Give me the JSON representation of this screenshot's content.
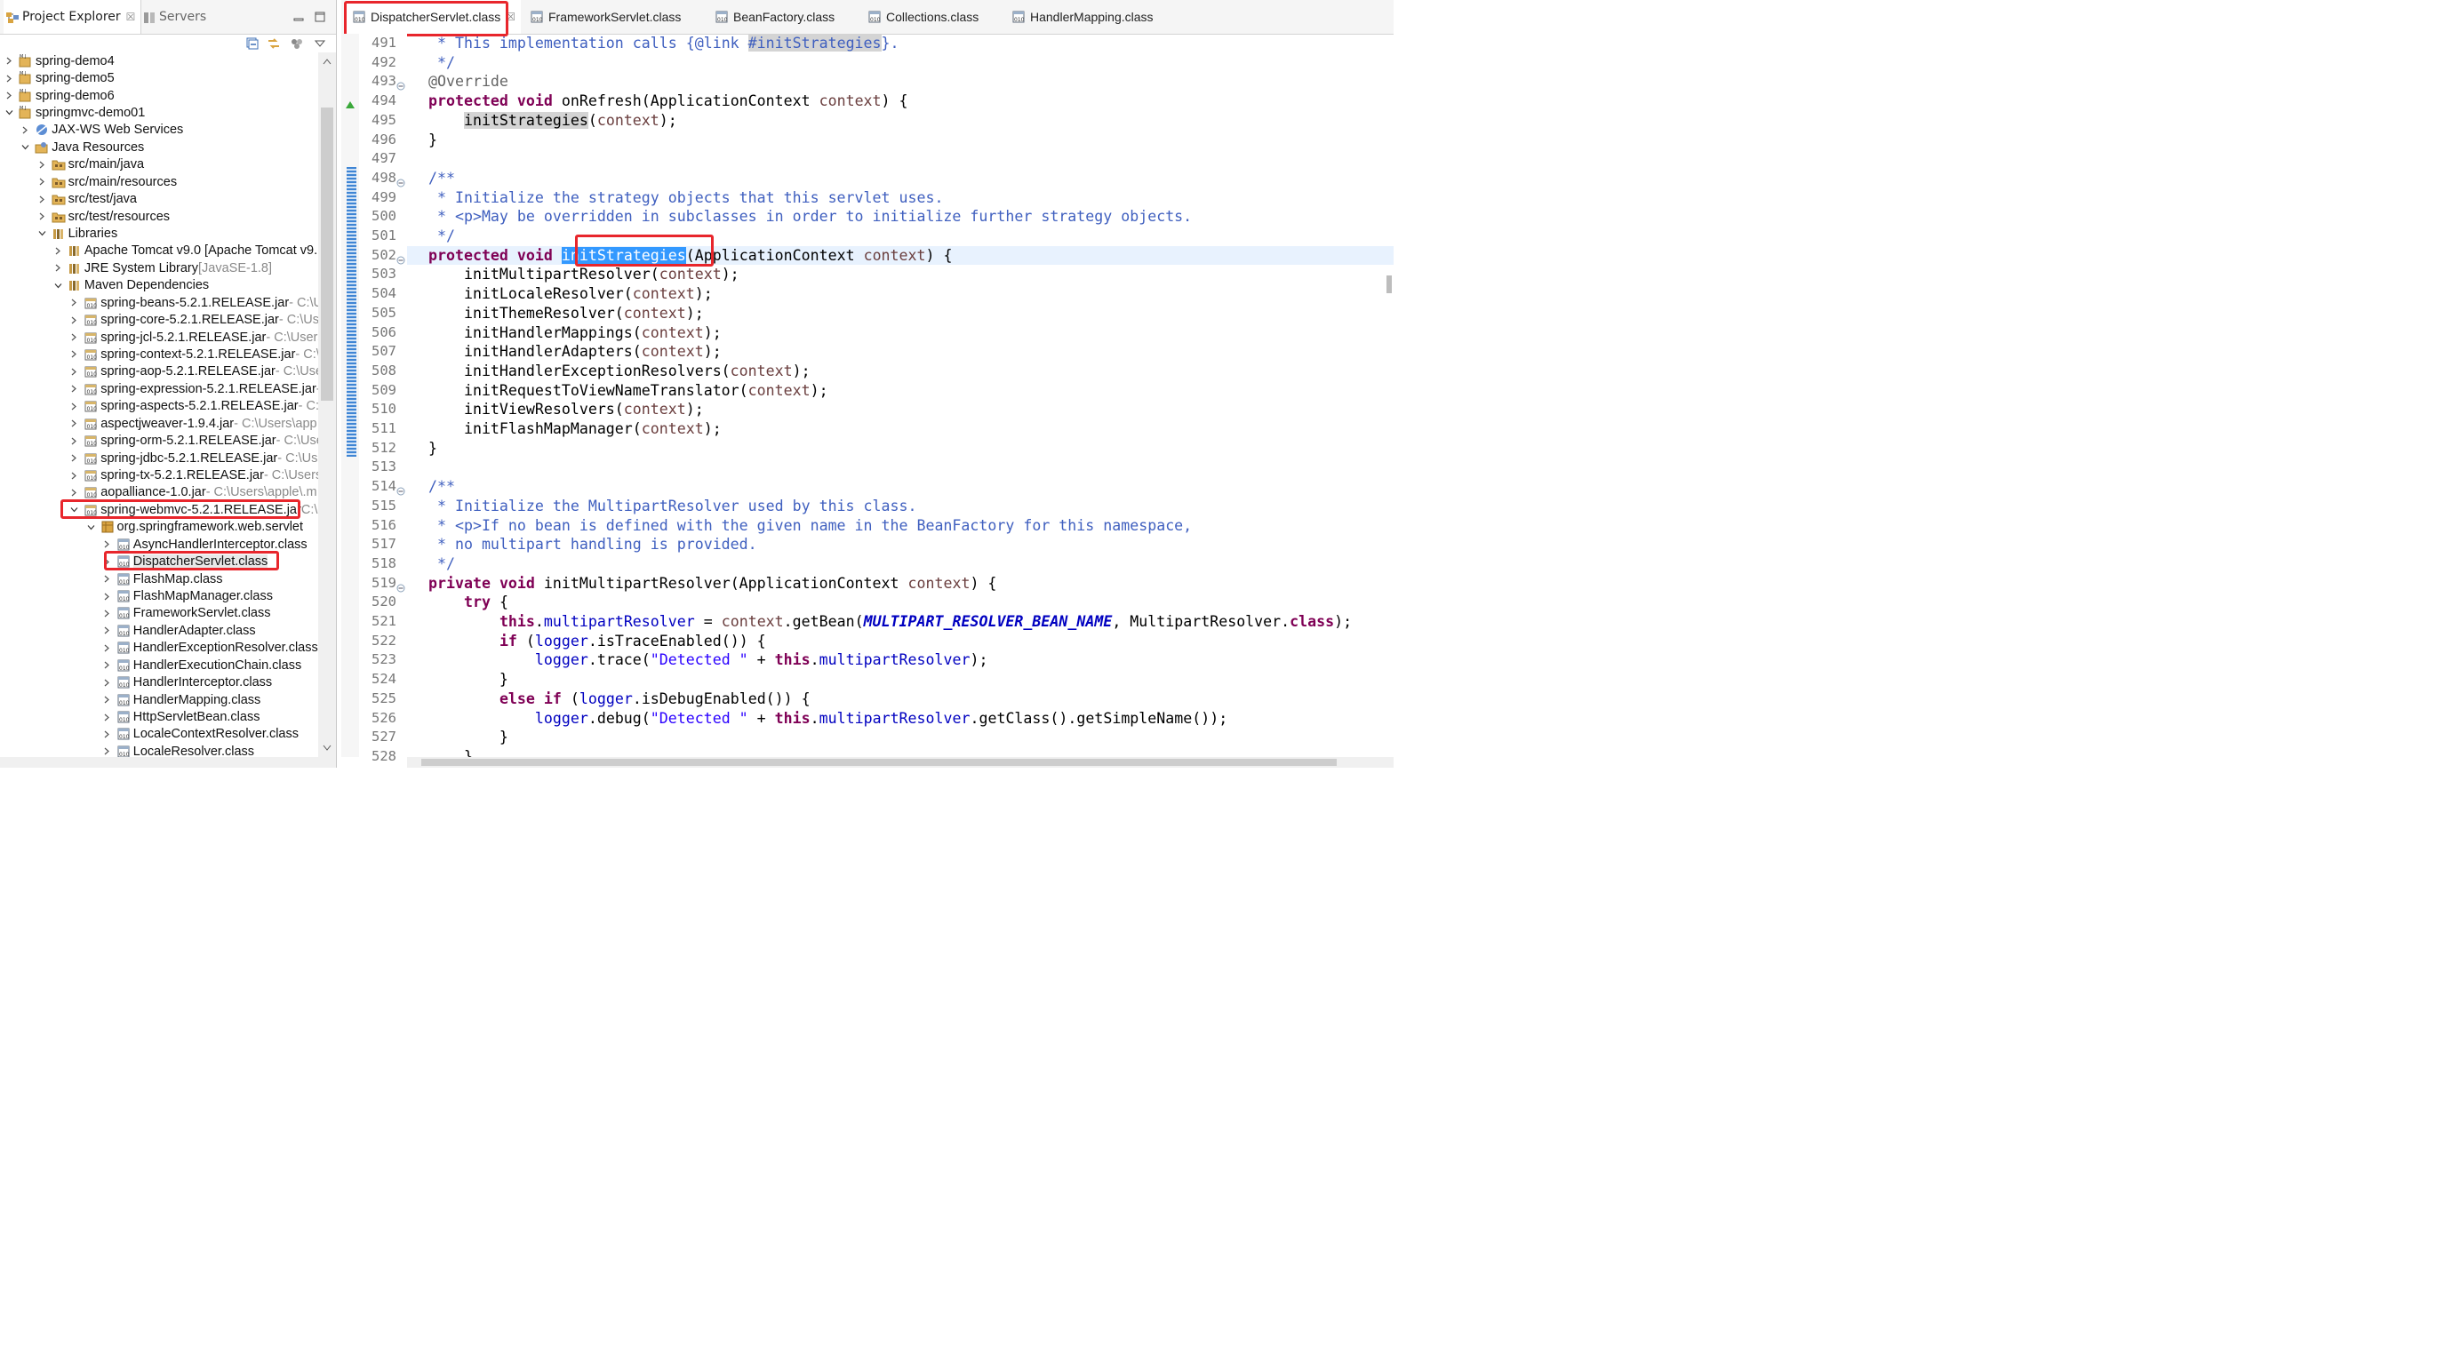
{
  "left_panel": {
    "tabs": [
      {
        "label": "Project Explorer",
        "close": "☒"
      },
      {
        "label": "Servers"
      }
    ],
    "tree": [
      {
        "indent": 0,
        "exp": "closed",
        "icon": "project",
        "label": "spring-demo4",
        "suffix": ""
      },
      {
        "indent": 0,
        "exp": "closed",
        "icon": "project",
        "label": "spring-demo5",
        "suffix": ""
      },
      {
        "indent": 0,
        "exp": "closed",
        "icon": "project",
        "label": "spring-demo6",
        "suffix": ""
      },
      {
        "indent": 0,
        "exp": "open",
        "icon": "project",
        "label": "springmvc-demo01",
        "suffix": ""
      },
      {
        "indent": 1,
        "exp": "closed",
        "icon": "webservice",
        "label": "JAX-WS Web Services",
        "suffix": ""
      },
      {
        "indent": 1,
        "exp": "open",
        "icon": "java-resources",
        "label": "Java Resources",
        "suffix": ""
      },
      {
        "indent": 2,
        "exp": "closed",
        "icon": "source-folder",
        "label": "src/main/java",
        "suffix": ""
      },
      {
        "indent": 2,
        "exp": "closed",
        "icon": "source-folder",
        "label": "src/main/resources",
        "suffix": ""
      },
      {
        "indent": 2,
        "exp": "closed",
        "icon": "source-folder",
        "label": "src/test/java",
        "suffix": ""
      },
      {
        "indent": 2,
        "exp": "closed",
        "icon": "source-folder",
        "label": "src/test/resources",
        "suffix": ""
      },
      {
        "indent": 2,
        "exp": "open",
        "icon": "library",
        "label": "Libraries",
        "suffix": ""
      },
      {
        "indent": 3,
        "exp": "closed",
        "icon": "library",
        "label": "Apache Tomcat v9.0 [Apache Tomcat v9.",
        "suffix": ""
      },
      {
        "indent": 3,
        "exp": "closed",
        "icon": "library",
        "label": "JRE System Library ",
        "suffix": "[JavaSE-1.8]"
      },
      {
        "indent": 3,
        "exp": "open",
        "icon": "library",
        "label": "Maven Dependencies",
        "suffix": ""
      },
      {
        "indent": 4,
        "exp": "closed",
        "icon": "jar",
        "label": "spring-beans-5.2.1.RELEASE.jar",
        "suffix": " - C:\\Us"
      },
      {
        "indent": 4,
        "exp": "closed",
        "icon": "jar",
        "label": "spring-core-5.2.1.RELEASE.jar",
        "suffix": " - C:\\Use"
      },
      {
        "indent": 4,
        "exp": "closed",
        "icon": "jar",
        "label": "spring-jcl-5.2.1.RELEASE.jar",
        "suffix": " - C:\\Users\\"
      },
      {
        "indent": 4,
        "exp": "closed",
        "icon": "jar",
        "label": "spring-context-5.2.1.RELEASE.jar",
        "suffix": " - C:\\U"
      },
      {
        "indent": 4,
        "exp": "closed",
        "icon": "jar",
        "label": "spring-aop-5.2.1.RELEASE.jar",
        "suffix": " - C:\\User"
      },
      {
        "indent": 4,
        "exp": "closed",
        "icon": "jar",
        "label": "spring-expression-5.2.1.RELEASE.jar",
        "suffix": " -"
      },
      {
        "indent": 4,
        "exp": "closed",
        "icon": "jar",
        "label": "spring-aspects-5.2.1.RELEASE.jar",
        "suffix": " - C:\\"
      },
      {
        "indent": 4,
        "exp": "closed",
        "icon": "jar",
        "label": "aspectjweaver-1.9.4.jar",
        "suffix": " - C:\\Users\\app"
      },
      {
        "indent": 4,
        "exp": "closed",
        "icon": "jar",
        "label": "spring-orm-5.2.1.RELEASE.jar",
        "suffix": " - C:\\Use"
      },
      {
        "indent": 4,
        "exp": "closed",
        "icon": "jar",
        "label": "spring-jdbc-5.2.1.RELEASE.jar",
        "suffix": " - C:\\Use"
      },
      {
        "indent": 4,
        "exp": "closed",
        "icon": "jar",
        "label": "spring-tx-5.2.1.RELEASE.jar",
        "suffix": " - C:\\Users\\"
      },
      {
        "indent": 4,
        "exp": "closed",
        "icon": "jar",
        "label": "aopalliance-1.0.jar",
        "suffix": " - C:\\Users\\apple\\.m"
      },
      {
        "indent": 4,
        "exp": "open",
        "icon": "jar",
        "label": "spring-webmvc-5.2.1.RELEASE.jar",
        "suffix": " C:\\"
      },
      {
        "indent": 5,
        "exp": "open",
        "icon": "package",
        "label": "org.springframework.web.servlet",
        "suffix": ""
      },
      {
        "indent": 6,
        "exp": "closed",
        "icon": "class-file",
        "label": "AsyncHandlerInterceptor.class",
        "suffix": ""
      },
      {
        "indent": 6,
        "exp": "closed",
        "icon": "class-file",
        "label": "DispatcherServlet.class",
        "suffix": "",
        "selected": true
      },
      {
        "indent": 6,
        "exp": "closed",
        "icon": "class-file",
        "label": "FlashMap.class",
        "suffix": ""
      },
      {
        "indent": 6,
        "exp": "closed",
        "icon": "class-file",
        "label": "FlashMapManager.class",
        "suffix": ""
      },
      {
        "indent": 6,
        "exp": "closed",
        "icon": "class-file",
        "label": "FrameworkServlet.class",
        "suffix": ""
      },
      {
        "indent": 6,
        "exp": "closed",
        "icon": "class-file",
        "label": "HandlerAdapter.class",
        "suffix": ""
      },
      {
        "indent": 6,
        "exp": "closed",
        "icon": "class-file",
        "label": "HandlerExceptionResolver.class",
        "suffix": ""
      },
      {
        "indent": 6,
        "exp": "closed",
        "icon": "class-file",
        "label": "HandlerExecutionChain.class",
        "suffix": ""
      },
      {
        "indent": 6,
        "exp": "closed",
        "icon": "class-file",
        "label": "HandlerInterceptor.class",
        "suffix": ""
      },
      {
        "indent": 6,
        "exp": "closed",
        "icon": "class-file",
        "label": "HandlerMapping.class",
        "suffix": ""
      },
      {
        "indent": 6,
        "exp": "closed",
        "icon": "class-file",
        "label": "HttpServletBean.class",
        "suffix": ""
      },
      {
        "indent": 6,
        "exp": "closed",
        "icon": "class-file",
        "label": "LocaleContextResolver.class",
        "suffix": ""
      },
      {
        "indent": 6,
        "exp": "closed",
        "icon": "class-file",
        "label": "LocaleResolver.class",
        "suffix": ""
      }
    ]
  },
  "editor": {
    "tabs": [
      {
        "label": "DispatcherServlet.class",
        "close": "☒"
      },
      {
        "label": "FrameworkServlet.class"
      },
      {
        "label": "BeanFactory.class"
      },
      {
        "label": "Collections.class"
      },
      {
        "label": "HandlerMapping.class"
      }
    ],
    "lines": [
      {
        "n": "491",
        "fold": "",
        "tokens": [
          [
            "cm",
            " * This implementation calls {"
          ],
          [
            "cm",
            "@link"
          ],
          [
            "cm",
            " "
          ],
          [
            "cm-occ",
            "#initStrategies"
          ],
          [
            "cm",
            "}."
          ]
        ]
      },
      {
        "n": "492",
        "fold": "",
        "tokens": [
          [
            "cm",
            " */"
          ]
        ]
      },
      {
        "n": "493",
        "fold": "⊖",
        "tokens": [
          [
            "ann",
            "@Override"
          ]
        ]
      },
      {
        "n": "494",
        "fold": "",
        "tokens": [
          [
            "kw",
            "protected"
          ],
          [
            "",
            " "
          ],
          [
            "kw",
            "void"
          ],
          [
            "",
            " onRefresh(ApplicationContext "
          ],
          [
            "par",
            "context"
          ],
          [
            "",
            ") {"
          ]
        ]
      },
      {
        "n": "495",
        "fold": "",
        "tokens": [
          [
            "",
            "    "
          ],
          [
            "occ",
            "initStrategies"
          ],
          [
            "",
            "("
          ],
          [
            "par",
            "context"
          ],
          [
            "",
            ");"
          ]
        ]
      },
      {
        "n": "496",
        "fold": "",
        "tokens": [
          [
            "",
            "}"
          ]
        ]
      },
      {
        "n": "497",
        "fold": "",
        "tokens": [
          [
            "",
            ""
          ]
        ]
      },
      {
        "n": "498",
        "fold": "⊖",
        "tokens": [
          [
            "cm",
            "/**"
          ]
        ]
      },
      {
        "n": "499",
        "fold": "",
        "tokens": [
          [
            "cm",
            " * Initialize the strategy objects that this servlet uses."
          ]
        ]
      },
      {
        "n": "500",
        "fold": "",
        "tokens": [
          [
            "cm",
            " * <p>May be overridden in subclasses in order to initialize further strategy objects."
          ]
        ]
      },
      {
        "n": "501",
        "fold": "",
        "tokens": [
          [
            "cm",
            " */"
          ]
        ]
      },
      {
        "n": "502",
        "fold": "⊖",
        "current": true,
        "tokens": [
          [
            "kw",
            "protected"
          ],
          [
            "",
            " "
          ],
          [
            "kw",
            "void"
          ],
          [
            "",
            " "
          ],
          [
            "sel",
            "initStrategies"
          ],
          [
            "",
            "(ApplicationContext "
          ],
          [
            "par",
            "context"
          ],
          [
            "",
            ") {"
          ]
        ]
      },
      {
        "n": "503",
        "fold": "",
        "tokens": [
          [
            "",
            "    initMultipartResolver("
          ],
          [
            "par",
            "context"
          ],
          [
            "",
            ");"
          ]
        ]
      },
      {
        "n": "504",
        "fold": "",
        "tokens": [
          [
            "",
            "    initLocaleResolver("
          ],
          [
            "par",
            "context"
          ],
          [
            "",
            ");"
          ]
        ]
      },
      {
        "n": "505",
        "fold": "",
        "tokens": [
          [
            "",
            "    initThemeResolver("
          ],
          [
            "par",
            "context"
          ],
          [
            "",
            ");"
          ]
        ]
      },
      {
        "n": "506",
        "fold": "",
        "tokens": [
          [
            "",
            "    initHandlerMappings("
          ],
          [
            "par",
            "context"
          ],
          [
            "",
            ");"
          ]
        ]
      },
      {
        "n": "507",
        "fold": "",
        "tokens": [
          [
            "",
            "    initHandlerAdapters("
          ],
          [
            "par",
            "context"
          ],
          [
            "",
            ");"
          ]
        ]
      },
      {
        "n": "508",
        "fold": "",
        "tokens": [
          [
            "",
            "    initHandlerExceptionResolvers("
          ],
          [
            "par",
            "context"
          ],
          [
            "",
            ");"
          ]
        ]
      },
      {
        "n": "509",
        "fold": "",
        "tokens": [
          [
            "",
            "    initRequestToViewNameTranslator("
          ],
          [
            "par",
            "context"
          ],
          [
            "",
            ");"
          ]
        ]
      },
      {
        "n": "510",
        "fold": "",
        "tokens": [
          [
            "",
            "    initViewResolvers("
          ],
          [
            "par",
            "context"
          ],
          [
            "",
            ");"
          ]
        ]
      },
      {
        "n": "511",
        "fold": "",
        "tokens": [
          [
            "",
            "    initFlashMapManager("
          ],
          [
            "par",
            "context"
          ],
          [
            "",
            ");"
          ]
        ]
      },
      {
        "n": "512",
        "fold": "",
        "tokens": [
          [
            "",
            "}"
          ]
        ]
      },
      {
        "n": "513",
        "fold": "",
        "tokens": [
          [
            "",
            ""
          ]
        ]
      },
      {
        "n": "514",
        "fold": "⊖",
        "tokens": [
          [
            "cm",
            "/**"
          ]
        ]
      },
      {
        "n": "515",
        "fold": "",
        "tokens": [
          [
            "cm",
            " * Initialize the MultipartResolver used by this class."
          ]
        ]
      },
      {
        "n": "516",
        "fold": "",
        "tokens": [
          [
            "cm",
            " * <p>If no bean is defined with the given name in the BeanFactory for this namespace,"
          ]
        ]
      },
      {
        "n": "517",
        "fold": "",
        "tokens": [
          [
            "cm",
            " * no multipart handling is provided."
          ]
        ]
      },
      {
        "n": "518",
        "fold": "",
        "tokens": [
          [
            "cm",
            " */"
          ]
        ]
      },
      {
        "n": "519",
        "fold": "⊖",
        "tokens": [
          [
            "kw",
            "private"
          ],
          [
            "",
            " "
          ],
          [
            "kw",
            "void"
          ],
          [
            "",
            " initMultipartResolver(ApplicationContext "
          ],
          [
            "par",
            "context"
          ],
          [
            "",
            ") {"
          ]
        ]
      },
      {
        "n": "520",
        "fold": "",
        "tokens": [
          [
            "",
            "    "
          ],
          [
            "kw",
            "try"
          ],
          [
            "",
            " {"
          ]
        ]
      },
      {
        "n": "521",
        "fold": "",
        "tokens": [
          [
            "",
            "        "
          ],
          [
            "kw",
            "this"
          ],
          [
            "",
            "."
          ],
          [
            "fld",
            "multipartResolver"
          ],
          [
            "",
            " = "
          ],
          [
            "par",
            "context"
          ],
          [
            "",
            ".getBean("
          ],
          [
            "cst",
            "MULTIPART_RESOLVER_BEAN_NAME"
          ],
          [
            "",
            ", MultipartResolver."
          ],
          [
            "kw",
            "class"
          ],
          [
            "",
            ");"
          ]
        ]
      },
      {
        "n": "522",
        "fold": "",
        "tokens": [
          [
            "",
            "        "
          ],
          [
            "kw",
            "if"
          ],
          [
            "",
            " ("
          ],
          [
            "fld",
            "logger"
          ],
          [
            "",
            ".isTraceEnabled()) {"
          ]
        ]
      },
      {
        "n": "523",
        "fold": "",
        "tokens": [
          [
            "",
            "            "
          ],
          [
            "fld",
            "logger"
          ],
          [
            "",
            ".trace("
          ],
          [
            "str",
            "\"Detected \""
          ],
          [
            "",
            " + "
          ],
          [
            "kw",
            "this"
          ],
          [
            "",
            "."
          ],
          [
            "fld",
            "multipartResolver"
          ],
          [
            "",
            ");"
          ]
        ]
      },
      {
        "n": "524",
        "fold": "",
        "tokens": [
          [
            "",
            "        }"
          ]
        ]
      },
      {
        "n": "525",
        "fold": "",
        "tokens": [
          [
            "",
            "        "
          ],
          [
            "kw",
            "else"
          ],
          [
            "",
            " "
          ],
          [
            "kw",
            "if"
          ],
          [
            "",
            " ("
          ],
          [
            "fld",
            "logger"
          ],
          [
            "",
            ".isDebugEnabled()) {"
          ]
        ]
      },
      {
        "n": "526",
        "fold": "",
        "tokens": [
          [
            "",
            "            "
          ],
          [
            "fld",
            "logger"
          ],
          [
            "",
            ".debug("
          ],
          [
            "str",
            "\"Detected \""
          ],
          [
            "",
            " + "
          ],
          [
            "kw",
            "this"
          ],
          [
            "",
            "."
          ],
          [
            "fld",
            "multipartResolver"
          ],
          [
            "",
            ".getClass().getSimpleName());"
          ]
        ]
      },
      {
        "n": "527",
        "fold": "",
        "tokens": [
          [
            "",
            "        }"
          ]
        ]
      },
      {
        "n": "528",
        "fold": "",
        "tokens": [
          [
            "",
            "    }"
          ]
        ]
      }
    ]
  },
  "colors": {
    "accent_red": "#e8262c",
    "keyword": "#7f0055",
    "comment": "#3f5fbf",
    "selection": "#3399ff"
  }
}
